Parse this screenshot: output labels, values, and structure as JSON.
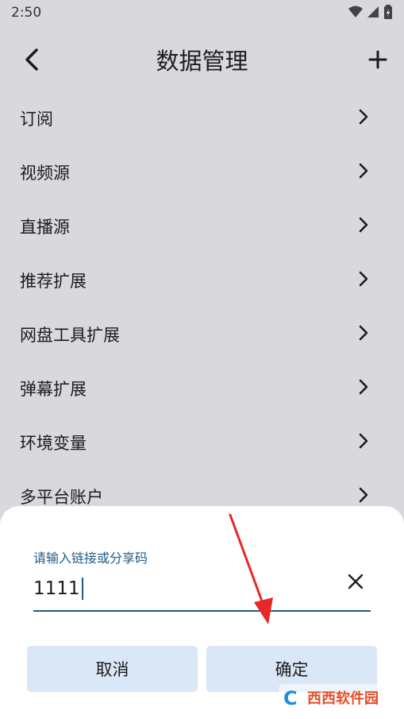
{
  "status": {
    "time": "2:50"
  },
  "header": {
    "title": "数据管理"
  },
  "list": {
    "items": [
      {
        "label": "订阅"
      },
      {
        "label": "视频源"
      },
      {
        "label": "直播源"
      },
      {
        "label": "推荐扩展"
      },
      {
        "label": "网盘工具扩展"
      },
      {
        "label": "弹幕扩展"
      },
      {
        "label": "环境变量"
      },
      {
        "label": "多平台账户"
      }
    ]
  },
  "dialog": {
    "field_label": "请输入链接或分享码",
    "input_value": "1111",
    "cancel_label": "取消",
    "confirm_label": "确定"
  },
  "colors": {
    "background": "#d9d8dc",
    "accent": "#1f5c86",
    "button_bg": "#d9e7f6",
    "arrow": "#e62828"
  },
  "watermark": {
    "text": "西西软件园"
  }
}
